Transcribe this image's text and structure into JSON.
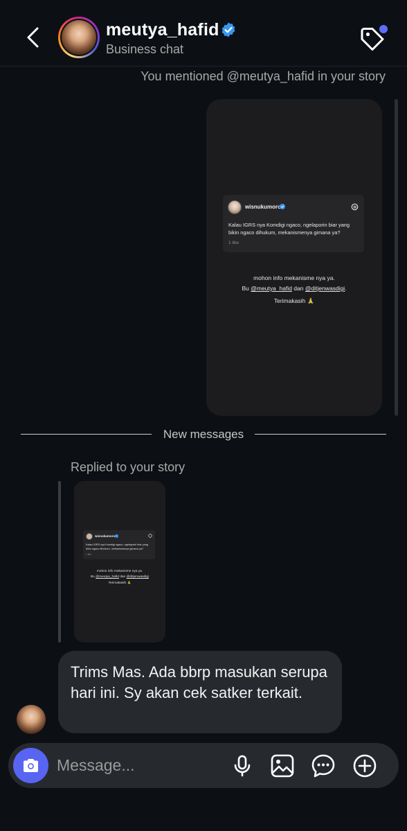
{
  "header": {
    "username": "meutya_hafid",
    "subtitle": "Business chat",
    "notification_dot_color": "#5b6ff5"
  },
  "mention_note": "You mentioned @meutya_hafid in your story",
  "story": {
    "post_author": "wisnukumoro",
    "post_text": "Kalau IGRS nya Komdigi ngaco, ngelaporin biar yang bikin ngaco dihukum, mekanismenya gimana ya?",
    "post_likes": "1 like",
    "caption_line1": "mohon info mekanisme nya ya.",
    "caption_prefix": "Bu",
    "caption_mention1": "@meutya_hafid",
    "caption_connector": "dan",
    "caption_mention2": "@ditjenwasdigi",
    "caption_suffix": ".",
    "caption_thanks": "Terimakasih 🙏"
  },
  "divider_label": "New messages",
  "replied_label": "Replied to your story",
  "message": {
    "text": "Trims Mas. Ada bbrp masukan serupa hari ini. Sy akan cek satker terkait."
  },
  "composer": {
    "placeholder": "Message...",
    "camera_color": "#5865f2"
  },
  "icons": [
    "back-arrow-icon",
    "verified-badge-icon",
    "tag-icon",
    "threads-icon",
    "camera-icon",
    "microphone-icon",
    "gallery-icon",
    "sticker-icon",
    "plus-icon"
  ]
}
